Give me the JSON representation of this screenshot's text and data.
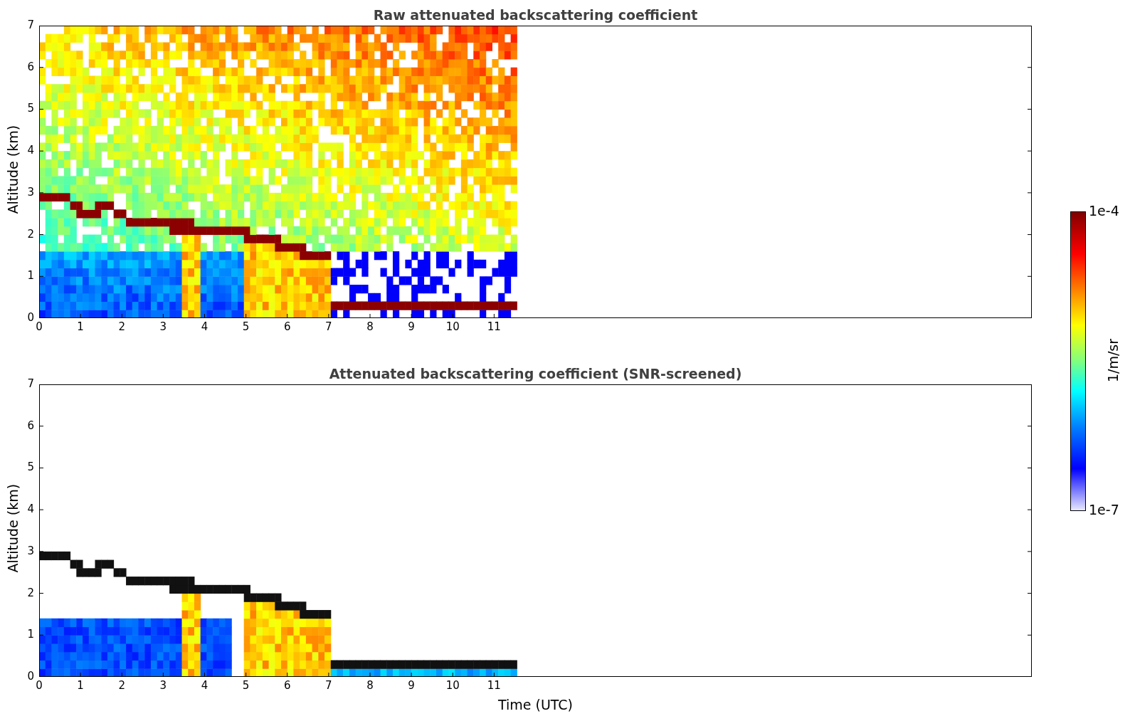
{
  "plots": [
    {
      "title": "Raw attenuated backscattering coefficient",
      "ylabel": "Altitude (km)",
      "kind": "raw",
      "yticks": [
        "7",
        "6",
        "5",
        "4",
        "3",
        "2",
        "1",
        "0"
      ],
      "xticks": [
        "0",
        "1",
        "2",
        "3",
        "4",
        "5",
        "6",
        "7",
        "8",
        "9",
        "10",
        "11"
      ]
    },
    {
      "title": "Attenuated backscattering coefficient (SNR-screened)",
      "ylabel": "Altitude (km)",
      "kind": "screened",
      "yticks": [
        "7",
        "6",
        "5",
        "4",
        "3",
        "2",
        "1",
        "0"
      ],
      "xticks": [
        "0",
        "1",
        "2",
        "3",
        "4",
        "5",
        "6",
        "7",
        "8",
        "9",
        "10",
        "11"
      ]
    }
  ],
  "xlabel": "Time (UTC)",
  "colorbar": {
    "max_label": "1e-4",
    "min_label": "1e-7",
    "label": "1/m/sr"
  }
}
